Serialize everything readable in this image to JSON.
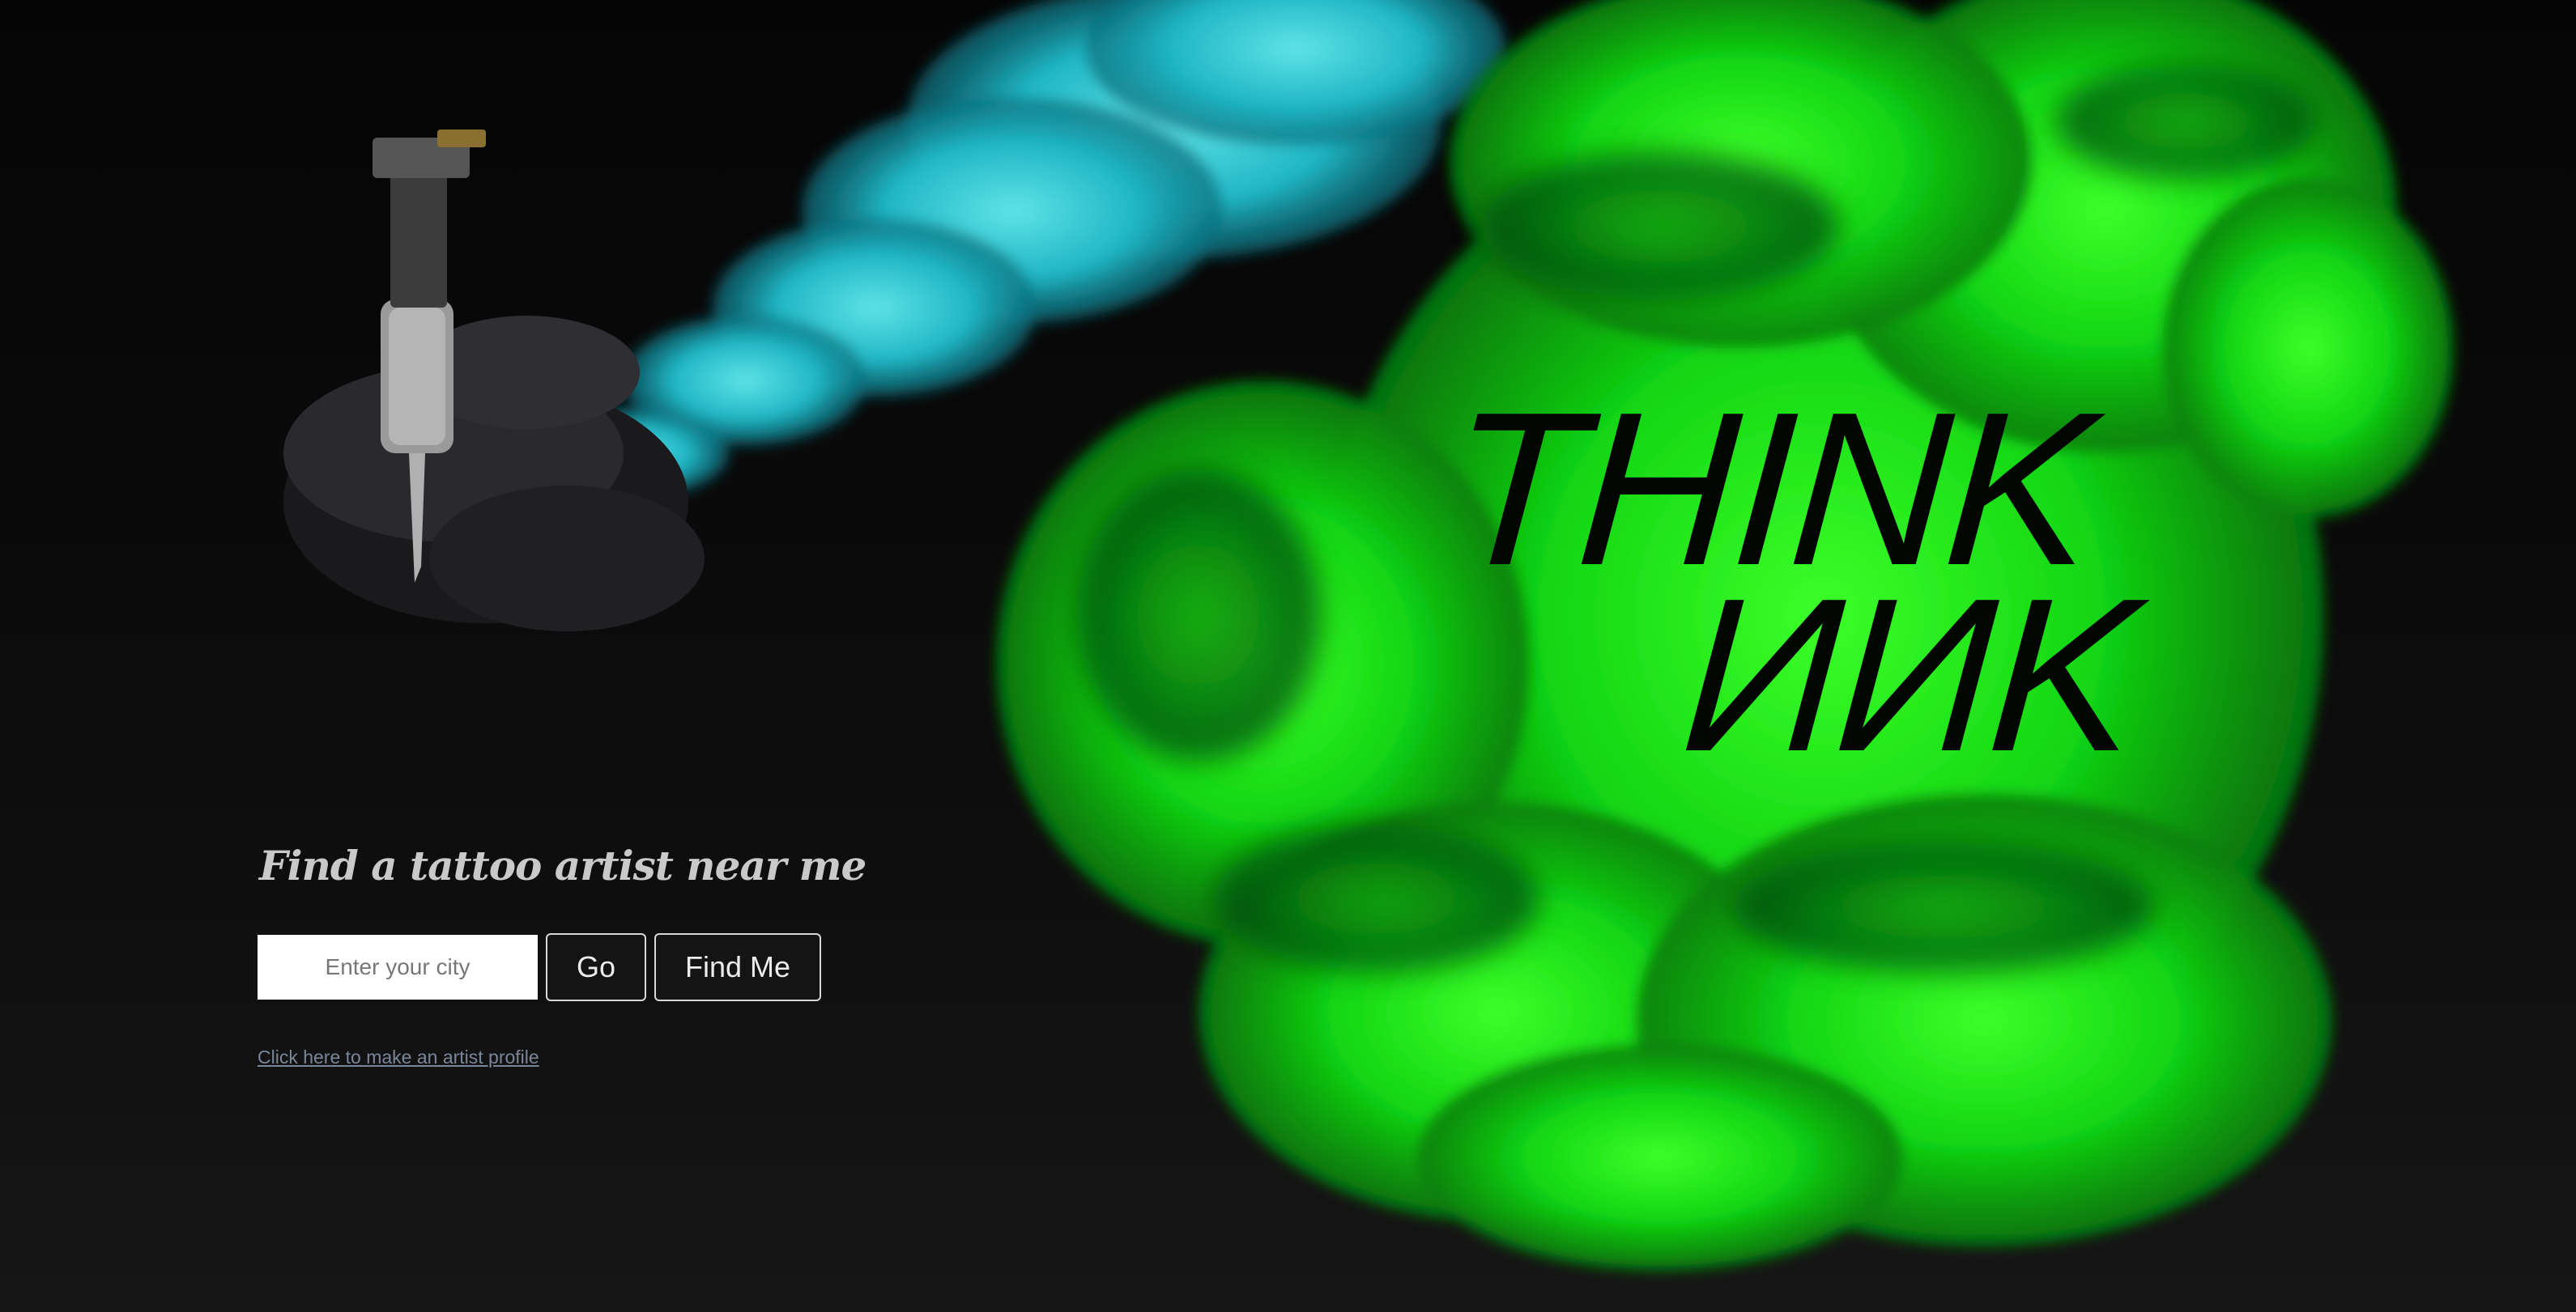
{
  "hero": {
    "wordmark_line1": "THINK",
    "wordmark_line2": "ИИK",
    "colors": {
      "ink_green": "#1fe81a",
      "ink_teal": "#2ec8c8",
      "background": "#0b0b0b"
    },
    "illustration": "tattoo-machine-ink-cloud"
  },
  "search": {
    "headline": "Find a tattoo artist near me",
    "city_placeholder": "Enter your city",
    "city_value": "",
    "go_label": "Go",
    "find_me_label": "Find Me",
    "profile_link": "Click here to make an artist profile"
  }
}
